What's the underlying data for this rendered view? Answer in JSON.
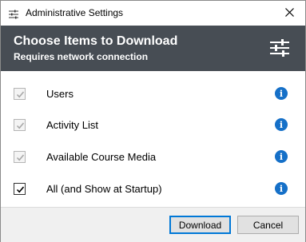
{
  "window": {
    "title": "Administrative Settings"
  },
  "header": {
    "title": "Choose Items to Download",
    "subtitle": "Requires network connection"
  },
  "items": [
    {
      "label": "Users",
      "checked": true,
      "disabled": true
    },
    {
      "label": "Activity List",
      "checked": true,
      "disabled": true
    },
    {
      "label": "Available Course Media",
      "checked": true,
      "disabled": true
    },
    {
      "label": "All (and Show at Startup)",
      "checked": true,
      "disabled": false
    }
  ],
  "info_glyph": "i",
  "footer": {
    "download_label": "Download",
    "cancel_label": "Cancel"
  },
  "colors": {
    "header_bg": "#474d54",
    "info_blue": "#1570c8",
    "primary_border": "#0078d7"
  },
  "icons": {
    "title_icon": "settings-sliders-icon",
    "header_icon": "settings-sliders-icon",
    "close_icon": "close-icon",
    "info_icon": "info-icon",
    "check_icon": "checkmark-icon"
  }
}
